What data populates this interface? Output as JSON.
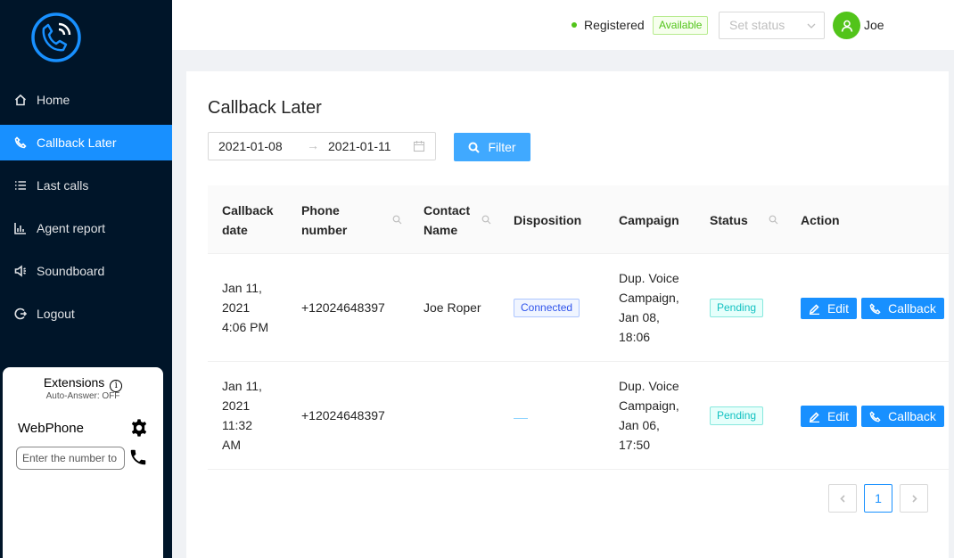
{
  "sidebar": {
    "items": [
      {
        "label": "Home",
        "icon": "home-icon"
      },
      {
        "label": "Callback Later",
        "icon": "phone-icon",
        "active": true
      },
      {
        "label": "Last calls",
        "icon": "list-icon"
      },
      {
        "label": "Agent report",
        "icon": "bar-chart-icon"
      },
      {
        "label": "Soundboard",
        "icon": "sound-icon"
      },
      {
        "label": "Logout",
        "icon": "logout-icon"
      }
    ]
  },
  "webphone": {
    "extensions_label": "Extensions",
    "info_glyph": "i",
    "auto_answer": "Auto-Answer: OFF",
    "title": "WebPhone",
    "input_placeholder": "Enter the number to call"
  },
  "header": {
    "registration": "Registered",
    "availability": "Available",
    "status_placeholder": "Set status",
    "user_name": "Joe"
  },
  "page": {
    "title": "Callback Later",
    "date_from": "2021-01-08",
    "date_separator": "→",
    "date_to": "2021-01-11",
    "filter_label": "Filter"
  },
  "table": {
    "columns": {
      "callback_date_1": "Callback",
      "callback_date_2": "date",
      "phone_1": "Phone",
      "phone_2": "number",
      "contact_1": "Contact",
      "contact_2": "Name",
      "disposition": "Disposition",
      "campaign": "Campaign",
      "status": "Status",
      "action": "Action"
    },
    "rows": [
      {
        "date_1": "Jan 11,",
        "date_2": "2021",
        "date_3": "4:06 PM",
        "date_4": "",
        "phone": "+12024648397",
        "contact": "Joe Roper",
        "disposition": "Connected",
        "campaign_1": "Dup. Voice",
        "campaign_2": "Campaign,",
        "campaign_3": "Jan 08,",
        "campaign_4": "18:06",
        "status": "Pending",
        "edit": "Edit",
        "callback": "Callback"
      },
      {
        "date_1": "Jan 11,",
        "date_2": "2021",
        "date_3": "11:32",
        "date_4": "AM",
        "phone": "+12024648397",
        "contact": "",
        "disposition": "",
        "campaign_1": "Dup. Voice",
        "campaign_2": "Campaign,",
        "campaign_3": "Jan 06,",
        "campaign_4": "17:50",
        "status": "Pending",
        "edit": "Edit",
        "callback": "Callback"
      }
    ]
  },
  "pagination": {
    "current": "1"
  },
  "colors": {
    "sidebar_bg": "#001529",
    "accent": "#1890ff",
    "available": "#52c41a",
    "pending": "#13c2c2",
    "connected": "#2f54eb"
  }
}
